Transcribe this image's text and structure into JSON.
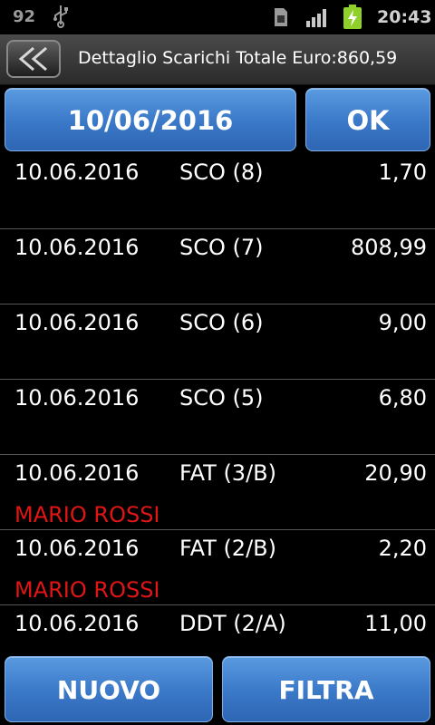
{
  "status_bar": {
    "notification_count": "92",
    "time": "20:43",
    "icons": [
      "usb-icon",
      "sim-icon",
      "signal-icon",
      "battery-charging-icon"
    ]
  },
  "header": {
    "back_icon": "back-chevron-icon",
    "title": "Dettaglio Scarichi Totale Euro:860,59"
  },
  "toolbar": {
    "date_label": "10/06/2016",
    "ok_label": "OK"
  },
  "rows": [
    {
      "date": "10.06.2016",
      "doc": "SCO (8)",
      "amount": "1,70",
      "name": ""
    },
    {
      "date": "10.06.2016",
      "doc": "SCO (7)",
      "amount": "808,99",
      "name": ""
    },
    {
      "date": "10.06.2016",
      "doc": "SCO (6)",
      "amount": "9,00",
      "name": ""
    },
    {
      "date": "10.06.2016",
      "doc": "SCO (5)",
      "amount": "6,80",
      "name": ""
    },
    {
      "date": "10.06.2016",
      "doc": "FAT (3/B)",
      "amount": "20,90",
      "name": "MARIO ROSSI"
    },
    {
      "date": "10.06.2016",
      "doc": "FAT (2/B)",
      "amount": "2,20",
      "name": "MARIO ROSSI"
    },
    {
      "date": "10.06.2016",
      "doc": "DDT (2/A)",
      "amount": "11,00",
      "name": ""
    }
  ],
  "footer": {
    "new_label": "NUOVO",
    "filter_label": "FILTRA"
  },
  "colors": {
    "button_blue": "#3a78c8",
    "customer_name_red": "#e01515",
    "background": "#000000"
  }
}
